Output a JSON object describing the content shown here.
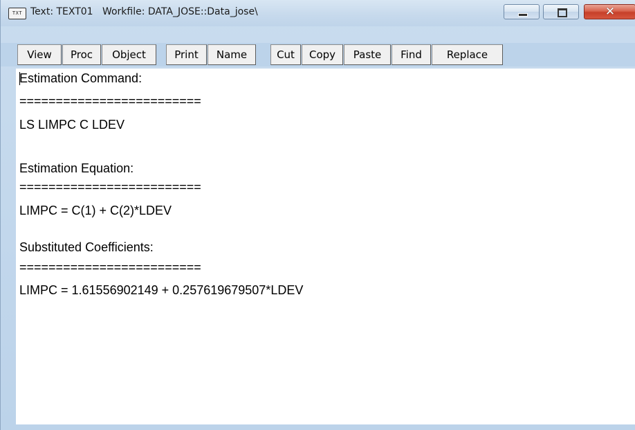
{
  "window": {
    "title": "Text: TEXT01   Workfile: DATA_JOSE::Data_jose\\",
    "icon_text": "TXT",
    "controls": {
      "minimize": "minimize",
      "maximize": "maximize",
      "close": "✕"
    }
  },
  "toolbar": {
    "buttons": [
      {
        "label": "View"
      },
      {
        "label": "Proc"
      },
      {
        "label": "Object"
      },
      {
        "label": "Print"
      },
      {
        "label": "Name"
      },
      {
        "label": "Cut"
      },
      {
        "label": "Copy"
      },
      {
        "label": "Paste"
      },
      {
        "label": "Find"
      },
      {
        "label": "Replace"
      }
    ]
  },
  "content": {
    "lines": [
      "Estimation Command:",
      "=========================",
      "LS LIMPC C LDEV",
      "",
      "Estimation Equation:",
      "=========================",
      "LIMPC = C(1) + C(2)*LDEV",
      "",
      "Substituted Coefficients:",
      "=========================",
      "LIMPC = 1.61556902149 + 0.257619679507*LDEV"
    ]
  }
}
